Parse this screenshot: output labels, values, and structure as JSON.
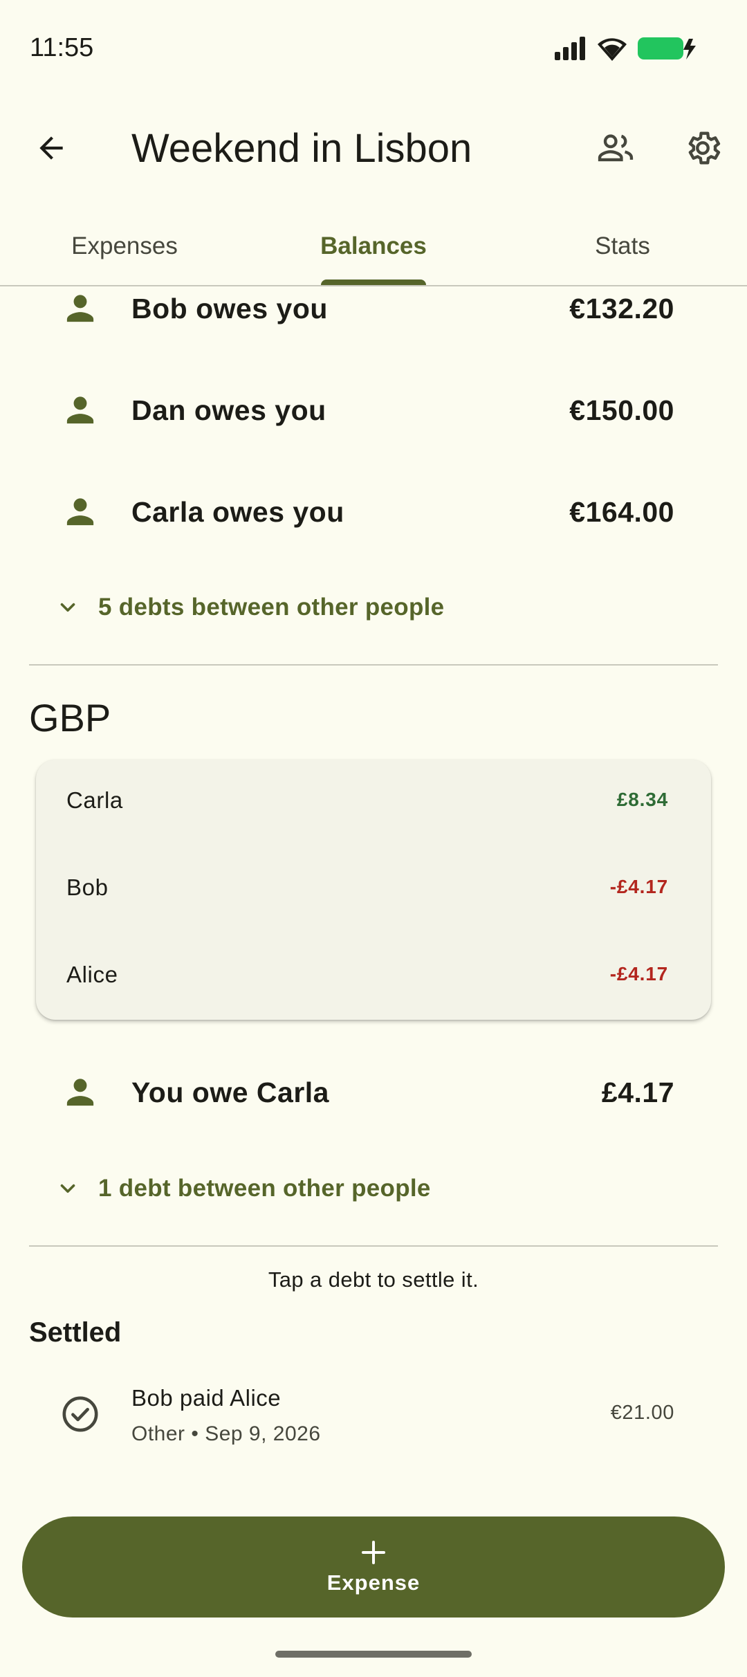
{
  "status_bar": {
    "time": "11:55",
    "icons": [
      "signal-icon",
      "wifi-icon",
      "battery-charging-icon"
    ]
  },
  "app_bar": {
    "title": "Weekend in Lisbon",
    "back_icon": "arrow-back-icon",
    "actions": [
      "people-icon",
      "gear-icon"
    ]
  },
  "tabs": [
    {
      "label": "Expenses",
      "active": false
    },
    {
      "label": "Balances",
      "active": true
    },
    {
      "label": "Stats",
      "active": false
    }
  ],
  "eur_section": {
    "debts": [
      {
        "text": "Bob owes you",
        "amount": "€132.20"
      },
      {
        "text": "Dan owes you",
        "amount": "€150.00"
      },
      {
        "text": "Carla owes you",
        "amount": "€164.00"
      }
    ],
    "expander_label": "5 debts between other people"
  },
  "gbp_section": {
    "heading": "GBP",
    "balances": [
      {
        "name": "Carla",
        "value": "£8.34",
        "color": "#2E6B35"
      },
      {
        "name": "Bob",
        "value": "-£4.17",
        "color": "#B3261E"
      },
      {
        "name": "Alice",
        "value": "-£4.17",
        "color": "#B3261E"
      }
    ],
    "debts": [
      {
        "text": "You owe Carla",
        "amount": "£4.17"
      }
    ],
    "expander_label": "1 debt between other people"
  },
  "hint": "Tap a debt to settle it.",
  "settled": {
    "heading": "Settled",
    "items": [
      {
        "title": "Bob paid Alice",
        "subtitle": "Other • Sep 9, 2026",
        "amount": "€21.00"
      }
    ]
  },
  "fab": {
    "label": "Expense",
    "icon": "plus-icon"
  },
  "colors": {
    "background": "#FCFCF0",
    "primary": "#56652A",
    "positive": "#2E6B35",
    "negative": "#B3261E"
  }
}
